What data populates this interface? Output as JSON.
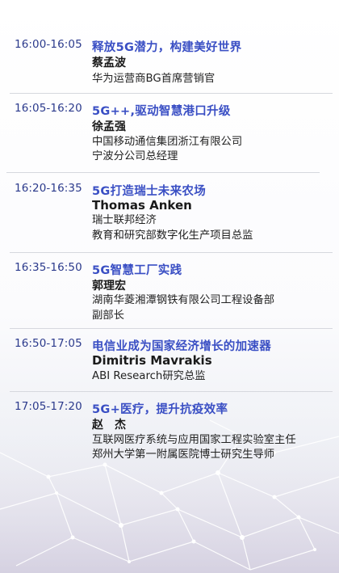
{
  "colors": {
    "time": "#2b3a8c",
    "title": "#3a4fc4",
    "speaker": "#1a1a1a",
    "divider": "#d6d8de"
  },
  "sessions": [
    {
      "time": "16:00-16:05",
      "title": "释放5G潜力，构建美好世界",
      "speaker": "蔡孟波",
      "roles": [
        "华为运营商BG首席营销官"
      ]
    },
    {
      "time": "16:05-16:20",
      "title": "5G++,驱动智慧港口升级",
      "speaker": "徐孟强",
      "roles": [
        "中国移动通信集团浙江有限公司",
        "宁波分公司总经理"
      ]
    },
    {
      "time": "16:20-16:35",
      "title": "5G打造瑞士未来农场",
      "speaker": "Thomas Anken",
      "roles": [
        "瑞士联邦经济",
        "教育和研究部数字化生产项目总监"
      ]
    },
    {
      "time": "16:35-16:50",
      "title": "5G智慧工厂实践",
      "speaker": "郭理宏",
      "roles": [
        "湖南华菱湘潭钢铁有限公司工程设备部",
        "副部长"
      ]
    },
    {
      "time": "16:50-17:05",
      "title": "电信业成为国家经济增长的加速器",
      "speaker": "Dimitris Mavrakis",
      "roles": [
        "ABI Research研究总监"
      ]
    },
    {
      "time": "17:05-17:20",
      "title": "5G+医疗，提升抗疫效率",
      "speaker": "赵　杰",
      "roles": [
        "互联网医疗系统与应用国家工程实验室主任",
        "郑州大学第一附属医院博士研究生导师"
      ]
    }
  ]
}
